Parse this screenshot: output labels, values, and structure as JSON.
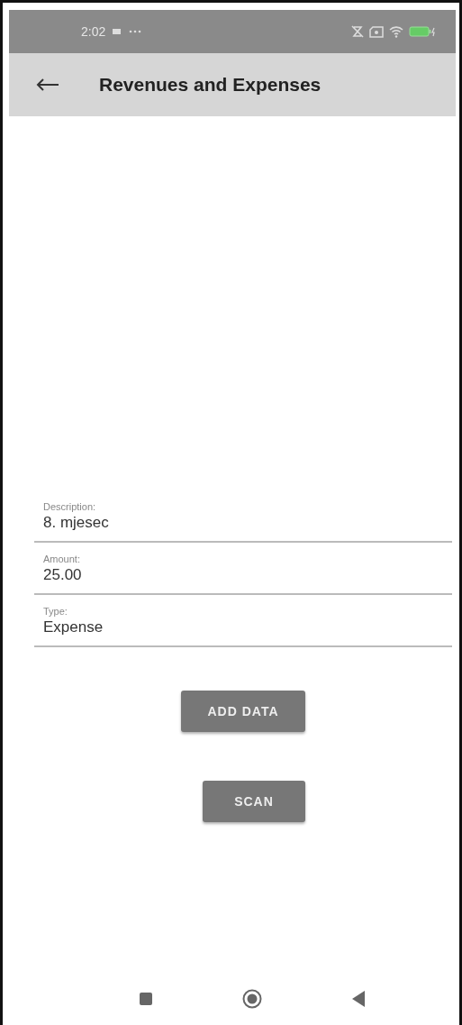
{
  "status_bar": {
    "time": "2:02"
  },
  "app_bar": {
    "title": "Revenues and Expenses"
  },
  "fields": [
    {
      "label": "Description:",
      "value": "8. mjesec"
    },
    {
      "label": "Amount:",
      "value": "25.00"
    },
    {
      "label": "Type:",
      "value": "Expense"
    }
  ],
  "buttons": [
    {
      "label": "ADD DATA"
    },
    {
      "label": "SCAN"
    }
  ]
}
